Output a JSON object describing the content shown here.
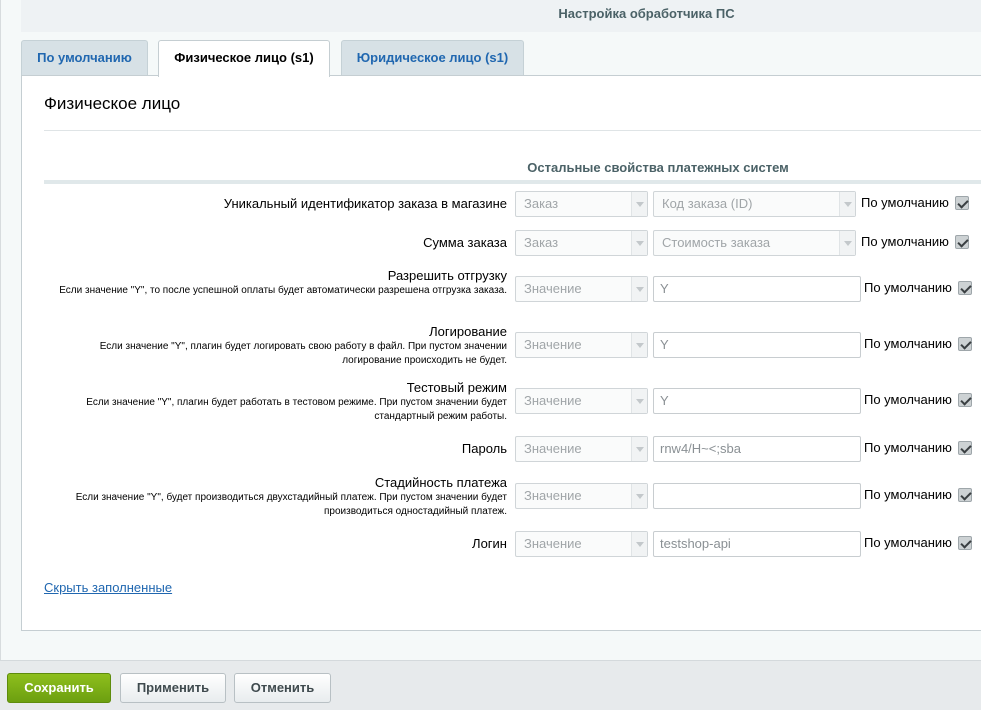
{
  "header": {
    "title": "Настройка обработчика ПС"
  },
  "tabs": [
    {
      "label": "По умолчанию"
    },
    {
      "label": "Физическое лицо (s1)"
    },
    {
      "label": "Юридическое лицо (s1)"
    }
  ],
  "panel": {
    "title": "Физическое лицо",
    "section_title": "Остальные свойства платежных систем",
    "hide_link": "Скрыть заполненные"
  },
  "default_label": "По умолчанию",
  "rows": [
    {
      "label": "Уникальный идентификатор заказа в магазине",
      "hint": "",
      "type_value": "Заказ",
      "field_value": "Код заказа (ID)",
      "field_kind": "select",
      "default_checked": true
    },
    {
      "label": "Сумма заказа",
      "hint": "",
      "type_value": "Заказ",
      "field_value": "Стоимость заказа",
      "field_kind": "select",
      "default_checked": true
    },
    {
      "label": "Разрешить отгрузку",
      "hint": "Если значение \"Y\", то после успешной оплаты будет автоматически разрешена отгрузка заказа.",
      "type_value": "Значение",
      "field_value": "Y",
      "field_kind": "input",
      "default_checked": true
    },
    {
      "label": "Логирование",
      "hint": "Если значение \"Y\", плагин будет логировать свою работу в файл. При пустом значении логирование происходить не будет.",
      "type_value": "Значение",
      "field_value": "Y",
      "field_kind": "input",
      "default_checked": true
    },
    {
      "label": "Тестовый режим",
      "hint": "Если значение \"Y\", плагин будет работать в тестовом режиме. При пустом значении будет стандартный режим работы.",
      "type_value": "Значение",
      "field_value": "Y",
      "field_kind": "input",
      "default_checked": true
    },
    {
      "label": "Пароль",
      "hint": "",
      "type_value": "Значение",
      "field_value": "rnw4/H~<;sba",
      "field_kind": "input",
      "default_checked": true
    },
    {
      "label": "Стадийность платежа",
      "hint": "Если значение \"Y\", будет производиться двухстадийный платеж. При пустом значении будет производиться одностадийный платеж.",
      "type_value": "Значение",
      "field_value": "",
      "field_kind": "input",
      "default_checked": true
    },
    {
      "label": "Логин",
      "hint": "",
      "type_value": "Значение",
      "field_value": "testshop-api",
      "field_kind": "input",
      "default_checked": true
    }
  ],
  "buttons": {
    "save": "Сохранить",
    "apply": "Применить",
    "cancel": "Отменить"
  }
}
